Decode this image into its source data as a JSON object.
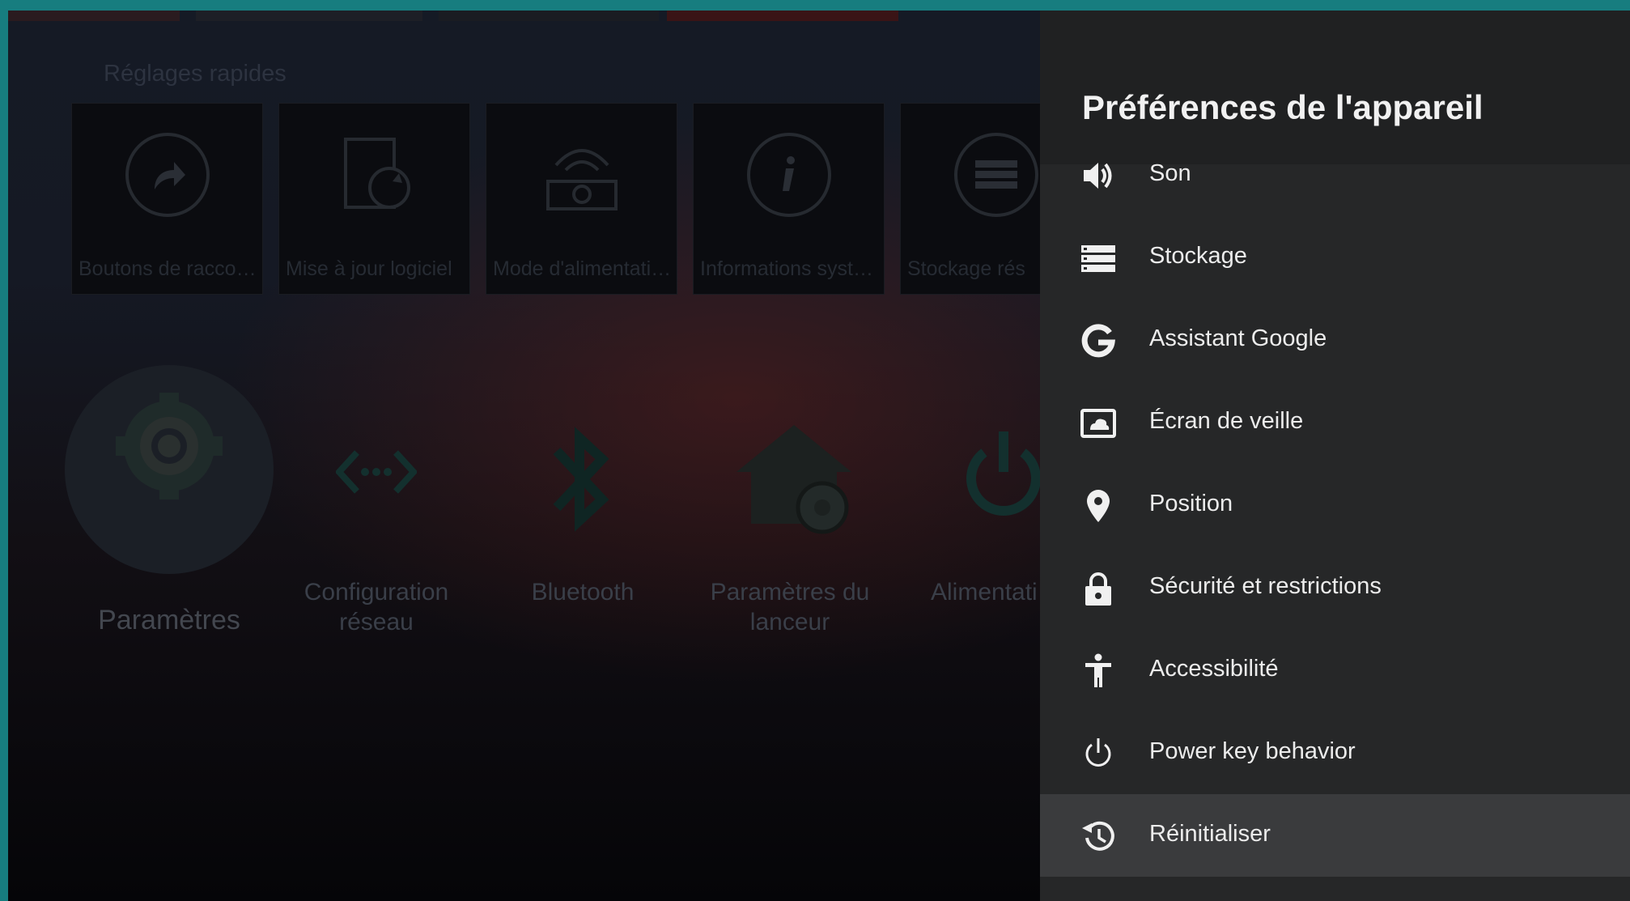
{
  "quick_settings": {
    "title": "Réglages rapides",
    "tiles": [
      {
        "label": "Boutons de raccou…",
        "icon": "shortcut-arrow-icon"
      },
      {
        "label": "Mise à jour logiciel",
        "icon": "system-update-icon"
      },
      {
        "label": "Mode d'alimentation",
        "icon": "power-mode-icon"
      },
      {
        "label": "Informations systè…",
        "icon": "info-icon"
      },
      {
        "label": "Stockage rés",
        "icon": "storage-icon"
      }
    ]
  },
  "apps": [
    {
      "label": "Paramètres",
      "icon": "settings-gear-icon"
    },
    {
      "label": "Configuration réseau",
      "icon": "network-icon"
    },
    {
      "label": "Bluetooth",
      "icon": "bluetooth-icon"
    },
    {
      "label": "Paramètres du lanceur",
      "icon": "launcher-settings-icon"
    },
    {
      "label": "Alimentati",
      "icon": "power-icon"
    }
  ],
  "panel": {
    "title": "Préférences de l'appareil",
    "items": [
      {
        "label": "Son",
        "icon": "speaker-icon"
      },
      {
        "label": "Stockage",
        "icon": "storage-icon"
      },
      {
        "label": "Assistant Google",
        "icon": "google-icon"
      },
      {
        "label": "Écran de veille",
        "icon": "screensaver-icon"
      },
      {
        "label": "Position",
        "icon": "location-pin-icon"
      },
      {
        "label": "Sécurité et restrictions",
        "icon": "lock-icon"
      },
      {
        "label": "Accessibilité",
        "icon": "accessibility-icon"
      },
      {
        "label": "Power key behavior",
        "icon": "power-icon"
      },
      {
        "label": "Réinitialiser",
        "icon": "restore-history-icon",
        "selected": true
      }
    ]
  },
  "colors": {
    "frame": "#177d7f",
    "panel_bg": "#262728",
    "panel_header_bg": "#202122",
    "selected_item_bg": "#3a3b3d",
    "text_primary": "#f1f1f1"
  }
}
